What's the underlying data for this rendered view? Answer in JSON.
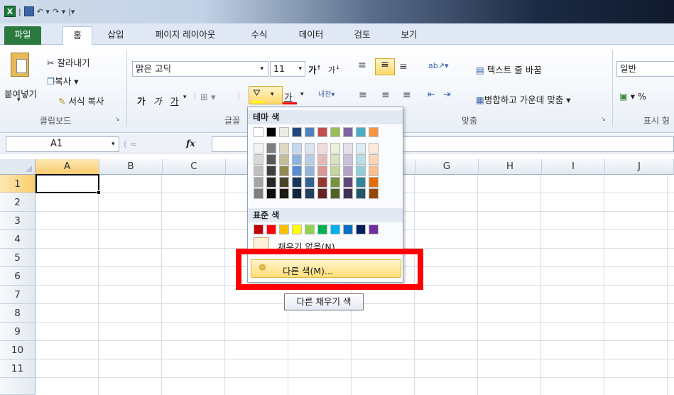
{
  "tabs": [
    "파일",
    "홈",
    "삽입",
    "페이지 레이아웃",
    "수식",
    "데이터",
    "검토",
    "보기"
  ],
  "clipboard": {
    "paste": "붙여넣기",
    "cut": "잘라내기",
    "copy": "복사",
    "format_painter": "서식 복사",
    "group": "클립보드"
  },
  "font": {
    "name": "맑은 고딕",
    "size": "11",
    "group": "글꼴",
    "bold": "가",
    "italic": "가",
    "underline": "가",
    "fontcolor": "가"
  },
  "alignment": {
    "wrap": "텍스트 줄 바꿈",
    "merge": "병합하고 가운데 맞춤",
    "group": "맞춤"
  },
  "number": {
    "format": "일반",
    "group": "표시 형",
    "percent": "%"
  },
  "formula": {
    "namebox": "A1",
    "fx": "fx"
  },
  "columns": [
    "A",
    "B",
    "C",
    "D",
    "E",
    "F",
    "G",
    "H",
    "I",
    "J"
  ],
  "rows": [
    "1",
    "2",
    "3",
    "4",
    "5",
    "6",
    "7",
    "8",
    "9",
    "10",
    "11"
  ],
  "colorpanel": {
    "theme_title": "테마 색",
    "standard_title": "표준 색",
    "no_fill": "채우기 없음(N)",
    "more_colors": "다른 색(M)...",
    "theme_top": [
      "#ffffff",
      "#000000",
      "#eeece1",
      "#1f497d",
      "#4f81bd",
      "#c0504d",
      "#9bbb59",
      "#8064a2",
      "#4bacc6",
      "#f79646"
    ],
    "theme_shades": [
      [
        "#f2f2f2",
        "#7f7f7f",
        "#ddd9c3",
        "#c6d9f0",
        "#dbe5f1",
        "#f2dcdb",
        "#ebf1dd",
        "#e5e0ec",
        "#dbeef3",
        "#fdeada"
      ],
      [
        "#d8d8d8",
        "#595959",
        "#c4bd97",
        "#8db3e2",
        "#b8cce4",
        "#e5b9b7",
        "#d7e3bc",
        "#ccc1d9",
        "#b7dde8",
        "#fbd5b5"
      ],
      [
        "#bfbfbf",
        "#3f3f3f",
        "#938953",
        "#548dd4",
        "#95b3d7",
        "#d99694",
        "#c3d69b",
        "#b2a2c7",
        "#92cddc",
        "#fac08f"
      ],
      [
        "#a5a5a5",
        "#262626",
        "#494429",
        "#17365d",
        "#366092",
        "#953734",
        "#76923c",
        "#5f497a",
        "#31859b",
        "#e36c09"
      ],
      [
        "#7f7f7f",
        "#0c0c0c",
        "#1d1b10",
        "#0f243e",
        "#244061",
        "#632423",
        "#4f6128",
        "#3f3151",
        "#205867",
        "#974806"
      ]
    ],
    "standard": [
      "#c00000",
      "#ff0000",
      "#ffc000",
      "#ffff00",
      "#92d050",
      "#00b050",
      "#00b0f0",
      "#0070c0",
      "#002060",
      "#7030a0"
    ]
  },
  "tooltip": "다른 채우기 색",
  "highlight_color": "#ff0000"
}
